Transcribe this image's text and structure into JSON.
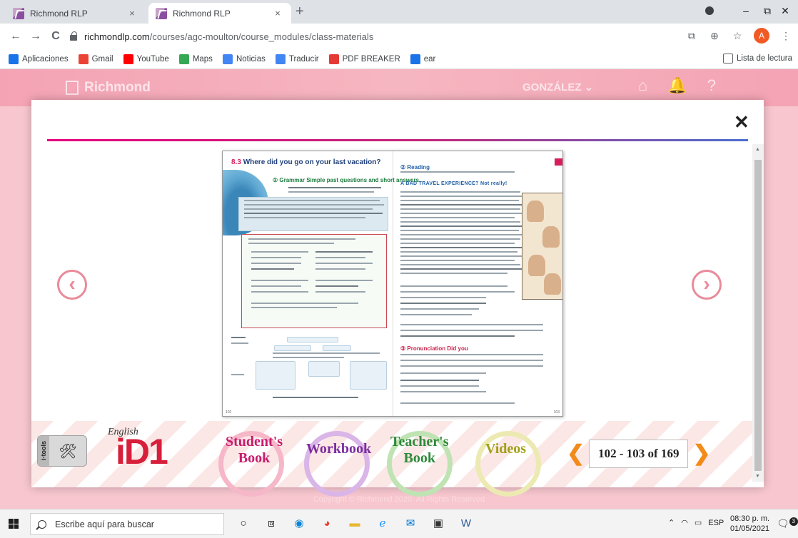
{
  "browser": {
    "tabs": [
      {
        "title": "Richmond RLP",
        "active": false
      },
      {
        "title": "Richmond RLP",
        "active": true
      }
    ],
    "tab_close_icon": "×",
    "new_tab_icon": "+",
    "window_controls": {
      "minimize": "–",
      "maximize": "⧉",
      "close": "✕"
    },
    "nav": {
      "back": "←",
      "forward": "→",
      "reload": "C"
    },
    "url_host": "richmondlp.com",
    "url_path": "/courses/agc-moulton/course_modules/class-materials",
    "profile_initial": "A",
    "bookmarks": [
      {
        "label": "Aplicaciones",
        "icon": "apps-grid",
        "color": "#1a73e8"
      },
      {
        "label": "Gmail",
        "icon": "gmail",
        "color": "#ea4335"
      },
      {
        "label": "YouTube",
        "icon": "youtube",
        "color": "#ff0000"
      },
      {
        "label": "Maps",
        "icon": "maps-pin",
        "color": "#34a853"
      },
      {
        "label": "Noticias",
        "icon": "google-news",
        "color": "#4285f4"
      },
      {
        "label": "Traducir",
        "icon": "translate",
        "color": "#4285f4"
      },
      {
        "label": "PDF BREAKER",
        "icon": "heart",
        "color": "#e53935"
      },
      {
        "label": "ear",
        "icon": "document",
        "color": "#1a73e8"
      }
    ],
    "reading_list": "Lista de lectura"
  },
  "site": {
    "logo": "Richmond",
    "user": "GONZÁLEZ",
    "copyright": "Copyright © Richmond 2020. All Rights Reserved"
  },
  "viewer": {
    "close_icon": "✕",
    "prev_icon": "‹",
    "next_icon": "›",
    "spread": {
      "unit_number": "8.3",
      "unit_title": "Where did you go on your last vacation?",
      "section_grammar": "① Grammar  Simple past questions and short answers",
      "section_reading": "② Reading",
      "article_title": "A BAD TRAVEL EXPERIENCE? Not really!",
      "section_pronunciation": "③ Pronunciation  Did you"
    },
    "toolbar": {
      "itools_label": "i-tools",
      "brand_small": "English",
      "brand_large": "iD1",
      "students_book": "Student's Book",
      "workbook": "Workbook",
      "teachers_book": "Teacher's Book",
      "videos": "Videos",
      "page_indicator": "102 - 103 of 169",
      "prev_page": "❮",
      "next_page": "❯"
    },
    "colors": {
      "students": "#c71c6e",
      "workbook": "#7b2c9e",
      "teachers": "#2f8a3a",
      "videos": "#a2a016",
      "pager_arrow": "#f28b1b"
    }
  },
  "taskbar": {
    "search_placeholder": "Escribe aquí para buscar",
    "apps": [
      "cortana",
      "task-view",
      "edge",
      "chrome",
      "file-explorer",
      "internet-explorer",
      "mail",
      "store",
      "word"
    ],
    "language": "ESP",
    "time": "08:30 p. m.",
    "date": "01/05/2021",
    "notifications": "3"
  }
}
